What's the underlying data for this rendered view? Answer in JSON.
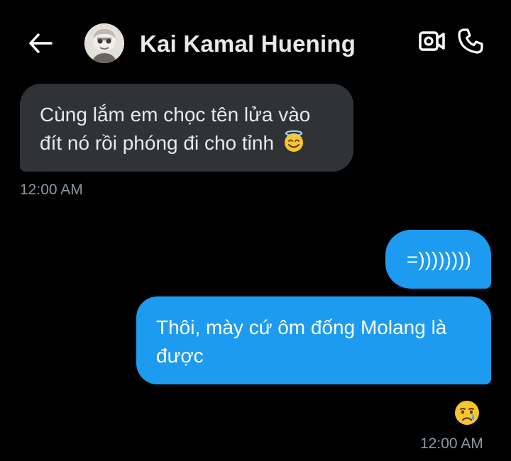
{
  "header": {
    "contact_name": "Kai Kamal Huening",
    "back_icon": "arrow-left-icon",
    "video_icon": "video-camera-icon",
    "call_icon": "phone-icon"
  },
  "messages": [
    {
      "direction": "incoming",
      "line1": "Cùng lắm em chọc tên lửa vào",
      "line2": "đít nó rồi phóng đi cho tỉnh",
      "emoji": "smiling-face-with-halo-emoji",
      "time": "12:00 AM"
    },
    {
      "direction": "outgoing",
      "text": "=))))))))"
    },
    {
      "direction": "outgoing",
      "line1": "Thôi, mày cứ ôm đống Molang là",
      "line2": "được",
      "reaction": "crying-face-emoji",
      "time": "12:00 AM"
    }
  ],
  "colors": {
    "background": "#000000",
    "incoming_bubble": "#2f3336",
    "outgoing_bubble": "#1d9bf0",
    "timestamp": "#8b98a5"
  }
}
